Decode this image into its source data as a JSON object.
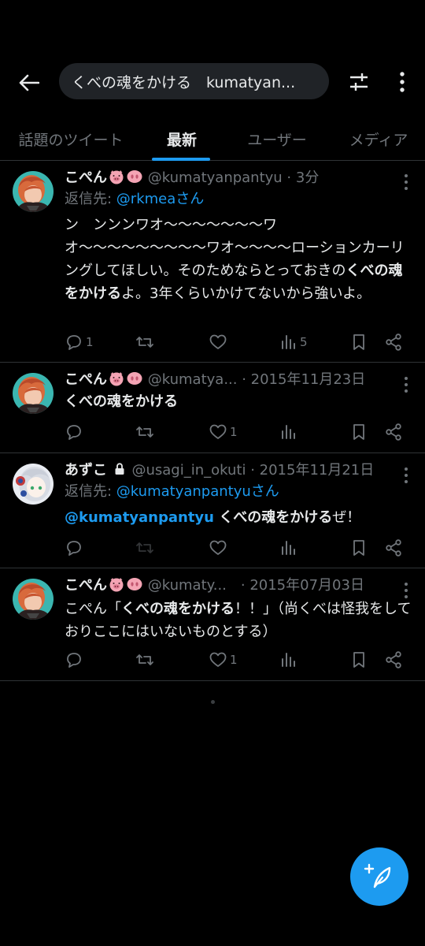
{
  "header": {
    "search_query": "くべの魂をかける　kumatyan...",
    "icons": {
      "back": "back-arrow-icon",
      "filter": "sliders-icon",
      "more": "more-vertical-icon"
    }
  },
  "tabs": [
    {
      "label": "話題のツイート",
      "active": false
    },
    {
      "label": "最新",
      "active": true
    },
    {
      "label": "ユーザー",
      "active": false
    },
    {
      "label": "メディア",
      "active": false
    }
  ],
  "tweets": [
    {
      "name": "こぺん",
      "handle_time": "@kumatyanpantyu · 3分",
      "reply_prefix": "返信先: ",
      "reply_mention": "@rkmeaさん",
      "text_before": "ン　ンンンワオ〜〜〜〜〜〜〜ワオ〜〜〜〜〜〜〜〜〜ワオ〜〜〜〜ローションカーリングしてほしい。そのためならとっておきの",
      "text_bold": "くべの魂をかける",
      "text_after": "よ。3年くらいかけてないから強いよ。",
      "replies": "1",
      "views": "5"
    },
    {
      "name": "こぺん",
      "handle_time": "@kumatya... · 2015年11月23日",
      "text_bold": "くべの魂をかける",
      "likes": "1"
    },
    {
      "name": "あずこ",
      "lock_icon": "lock-icon",
      "handle_time": "@usagi_in_okuti · 2015年11月21日",
      "reply_prefix": "返信先: ",
      "reply_mention": "@kumatyanpantyuさん",
      "text_mention": "@kumatyanpantyu",
      "text_bold": " くべの魂をかける",
      "text_after": "ぜ！"
    },
    {
      "name": "こぺん",
      "handle_time": "@kumaty...　· 2015年07月03日",
      "text_before": "こぺん「",
      "text_bold": "くべの魂をかける",
      "text_after": "！！」（尚くべは怪我をしておりここにはいないものとする）",
      "likes": "1"
    }
  ],
  "colors": {
    "accent": "#1d9bf0",
    "secondary_text": "#71767b",
    "background": "#000000"
  },
  "fab_icon": "compose-icon"
}
